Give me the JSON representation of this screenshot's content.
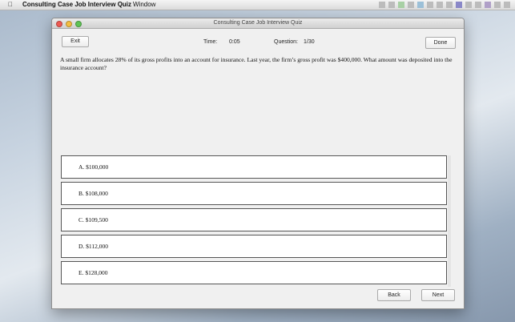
{
  "menubar": {
    "apple_icon": "apple-icon",
    "app_name": "Consulting Case Job Interview Quiz",
    "menu_window": "Window"
  },
  "window": {
    "title": "Consulting Case Job Interview Quiz"
  },
  "toolbar": {
    "exit_label": "Exit",
    "time_label": "Time:",
    "time_value": "0:05",
    "question_label": "Question:",
    "question_value": "1/30",
    "done_label": "Done"
  },
  "question": {
    "text": "A small firm allocates 28% of its gross profits into an account for insurance. Last year, the firm’s gross profit was $400,000. What amount was deposited into the insurance account?"
  },
  "answers": [
    {
      "label": "A. $100,000"
    },
    {
      "label": "B. $108,000"
    },
    {
      "label": "C. $109,500"
    },
    {
      "label": "D. $112,000"
    },
    {
      "label": "E. $128,000"
    }
  ],
  "navigation": {
    "back_label": "Back",
    "next_label": "Next"
  }
}
